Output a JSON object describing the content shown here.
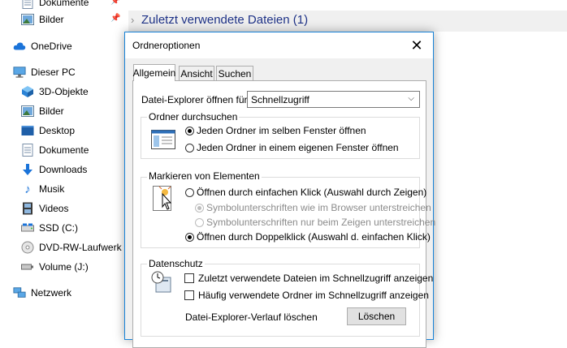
{
  "sidebar": {
    "quick_items": [
      {
        "label": "Dokumente",
        "icon": "documents-icon"
      },
      {
        "label": "Bilder",
        "icon": "pictures-icon"
      }
    ],
    "onedrive": "OneDrive",
    "this_pc": "Dieser PC",
    "pc_items": [
      {
        "label": "3D-Objekte",
        "icon": "3d-objects-icon"
      },
      {
        "label": "Bilder",
        "icon": "pictures-icon"
      },
      {
        "label": "Desktop",
        "icon": "desktop-icon"
      },
      {
        "label": "Dokumente",
        "icon": "documents-icon"
      },
      {
        "label": "Downloads",
        "icon": "downloads-icon"
      },
      {
        "label": "Musik",
        "icon": "music-icon"
      },
      {
        "label": "Videos",
        "icon": "videos-icon"
      },
      {
        "label": "SSD (C:)",
        "icon": "drive-icon"
      },
      {
        "label": "DVD-RW-Laufwerk",
        "icon": "dvd-icon"
      },
      {
        "label": "Volume (J:)",
        "icon": "usb-drive-icon"
      }
    ],
    "network": "Netzwerk"
  },
  "main": {
    "section_title": "Zuletzt verwendete Dateien (1)"
  },
  "dialog": {
    "title": "Ordneroptionen",
    "tabs": [
      "Allgemein",
      "Ansicht",
      "Suchen"
    ],
    "active_tab": "Allgemein",
    "open_with_label": "Datei-Explorer öffnen für:",
    "open_with_value": "Schnellzugriff",
    "browse_group": {
      "title": "Ordner durchsuchen",
      "options": [
        "Jeden Ordner im selben Fenster öffnen",
        "Jeden Ordner in einem eigenen Fenster öffnen"
      ],
      "selected": 0
    },
    "click_group": {
      "title": "Markieren von Elementen",
      "single_click": "Öffnen durch einfachen Klick (Auswahl durch Zeigen)",
      "underline_browser": "Symbolunterschriften wie im Browser unterstreichen",
      "underline_hover": "Symbolunterschriften nur beim Zeigen unterstreichen",
      "double_click": "Öffnen durch Doppelklick (Auswahl d. einfachen Klick)",
      "selected": "double_click"
    },
    "privacy_group": {
      "title": "Datenschutz",
      "recent_files": "Zuletzt verwendete Dateien im Schnellzugriff anzeigen",
      "frequent_folders": "Häufig verwendete Ordner im Schnellzugriff anzeigen",
      "history_label": "Datei-Explorer-Verlauf löschen",
      "clear_button": "Löschen"
    }
  }
}
